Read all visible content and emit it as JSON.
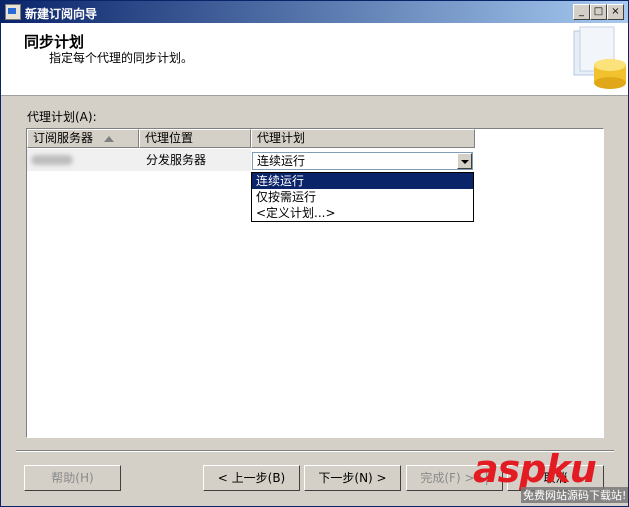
{
  "window": {
    "title": "新建订阅向导",
    "buttons": {
      "minimize": "_",
      "maximize": "□",
      "close": "×"
    }
  },
  "header": {
    "title": "同步计划",
    "subtitle": "指定每个代理的同步计划。",
    "art_icon": "database-wizard-icon"
  },
  "agents_label": "代理计划(A):",
  "grid": {
    "columns": [
      "订阅服务器",
      "代理位置",
      "代理计划"
    ],
    "sort_icon": "sort-ascending-icon",
    "rows": [
      {
        "subscriber": "",
        "location": "分发服务器",
        "schedule": "连续运行"
      }
    ]
  },
  "dropdown": {
    "options": [
      "连续运行",
      "仅按需运行",
      "<定义计划...>"
    ],
    "selected_index": 0
  },
  "footer": {
    "help": "帮助(H)",
    "back": "< 上一步(B)",
    "next": "下一步(N) >",
    "finish": "完成(F) >>|",
    "cancel": "取消"
  },
  "watermark": {
    "logo": "aspku",
    "tagline": "免费网站源码下载站!"
  },
  "colors": {
    "title_gradient_start": "#0a246a",
    "title_gradient_end": "#a6caf0",
    "selection": "#0a246a",
    "watermark_red": "#e31b23"
  }
}
